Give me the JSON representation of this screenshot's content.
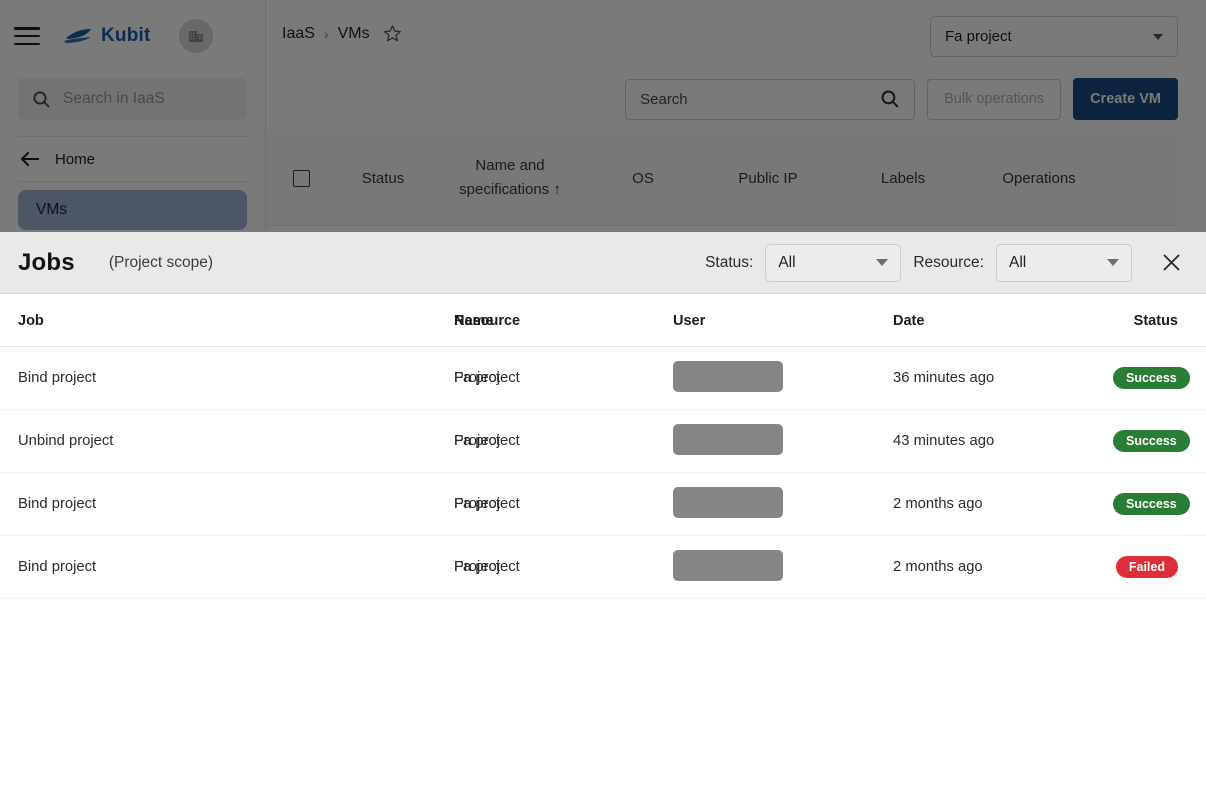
{
  "background": {
    "sidebar": {
      "menu_icon": "hamburger-menu-icon",
      "brand_name": "Kubit",
      "brand_logo_icon": "kubit-boat-logo-icon",
      "org_switch_icon": "organization-building-icon",
      "search_placeholder": "Search in IaaS",
      "search_icon": "search-icon",
      "back_icon": "arrow-left-icon",
      "home_label": "Home",
      "active_item_label": "VMs"
    },
    "breadcrumb": {
      "root": "IaaS",
      "separator": "›",
      "current": "VMs",
      "favorite_icon": "star-outline-icon"
    },
    "project_selector": {
      "value": "Fa project",
      "caret_icon": "chevron-down-icon"
    },
    "toolbar": {
      "search_placeholder": "Search",
      "search_icon": "search-icon",
      "bulk_operations_label": "Bulk operations",
      "create_vm_label": "Create VM",
      "create_vm_color": "#1a4d85"
    },
    "vm_table_headers": [
      "Status",
      "Name and specifications ↑",
      "OS",
      "Public IP",
      "Labels",
      "Operations"
    ]
  },
  "jobs_modal": {
    "title": "Jobs",
    "scope": "(Project scope)",
    "filters": [
      {
        "label": "Status:",
        "value": "All",
        "caret_icon": "chevron-down-icon"
      },
      {
        "label": "Resource:",
        "value": "All",
        "caret_icon": "chevron-down-icon"
      }
    ],
    "close_icon": "close-icon",
    "columns": [
      "Job",
      "Resource",
      "Name",
      "User",
      "Date",
      "Status"
    ],
    "rows": [
      {
        "job": "Bind project",
        "resource": "Project",
        "name": "Fa project",
        "user": "",
        "date": "36 minutes ago",
        "status": "Success",
        "status_color": "#2a7d34"
      },
      {
        "job": "Unbind project",
        "resource": "Project",
        "name": "Fa project",
        "user": "",
        "date": "43 minutes ago",
        "status": "Success",
        "status_color": "#2a7d34"
      },
      {
        "job": "Bind project",
        "resource": "Project",
        "name": "Fa project",
        "user": "",
        "date": "2 months ago",
        "status": "Success",
        "status_color": "#2a7d34"
      },
      {
        "job": "Bind project",
        "resource": "Project",
        "name": "Fa project",
        "user": "",
        "date": "2 months ago",
        "status": "Failed",
        "status_color": "#dc2f38"
      }
    ]
  }
}
